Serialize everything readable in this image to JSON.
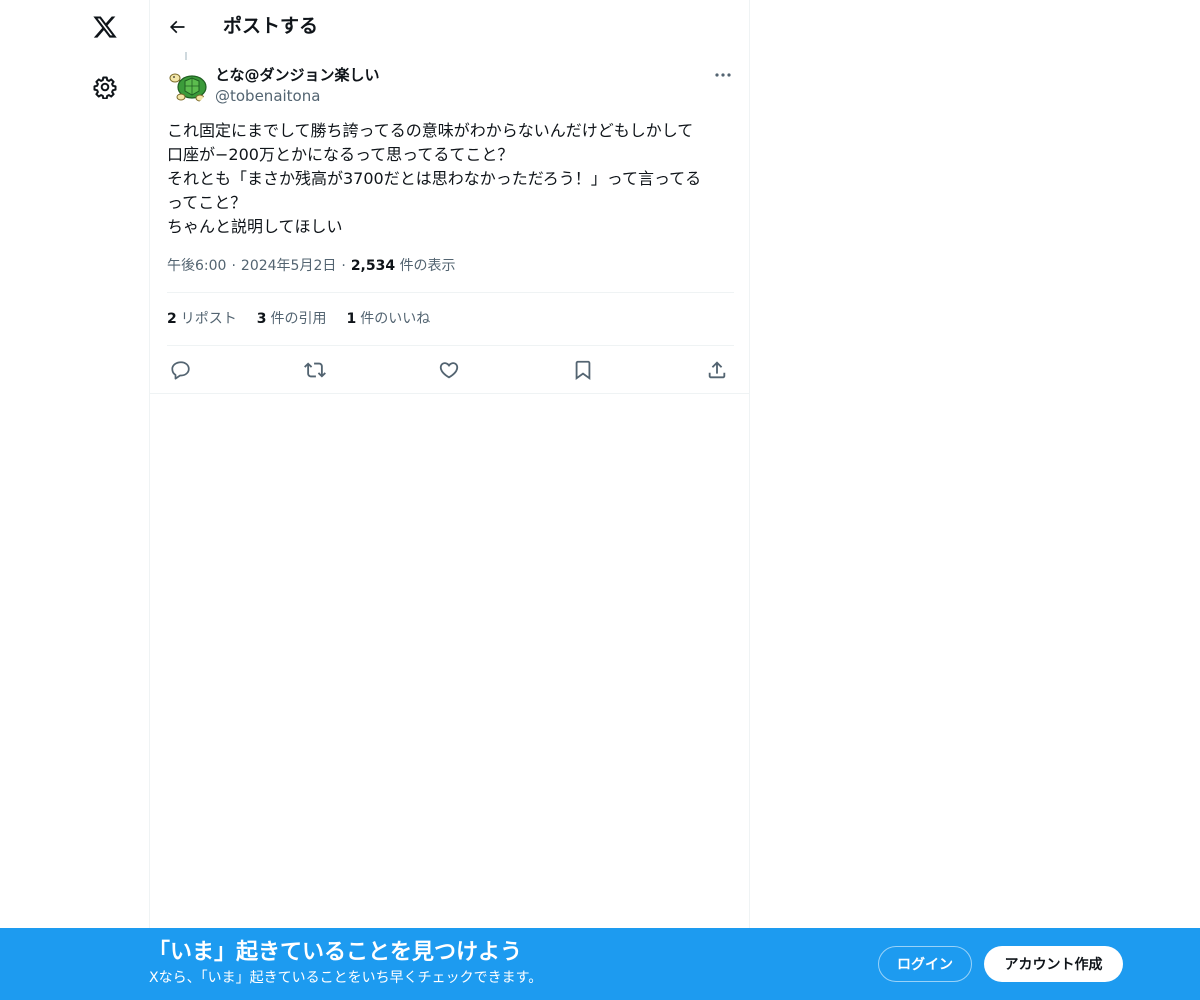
{
  "nav": {
    "logo_icon": "x-logo-icon",
    "settings_icon": "gear-icon"
  },
  "header": {
    "back_icon": "arrow-left-icon",
    "title": "ポストする"
  },
  "post": {
    "author": {
      "name": "とな@ダンジョン楽しい",
      "handle": "@tobenaitona",
      "avatar_icon": "turtle-avatar"
    },
    "more_icon": "more-dots-icon",
    "text_lines": [
      "これ固定にまでして勝ち誇ってるの意味がわからないんだけどもしかして",
      "口座が−200万とかになるって思ってるてこと？",
      "それとも「まさか残高が3700だとは思わなかっただろう！」って言ってる",
      "ってこと？",
      "ちゃんと説明してほしい"
    ],
    "time": "午後6:00",
    "date": "2024年5月2日",
    "dot": "·",
    "views_count": "2,534",
    "views_label": "件の表示",
    "stats": {
      "reposts_count": "2",
      "reposts_label": "リポスト",
      "quotes_count": "3",
      "quotes_label": "件の引用",
      "likes_count": "1",
      "likes_label": "件のいいね"
    },
    "actions": [
      "reply-icon",
      "repost-icon",
      "like-icon",
      "bookmark-icon",
      "share-icon"
    ]
  },
  "banner": {
    "title": "「いま」起きていることを見つけよう",
    "subtitle": "Xなら、「いま」起きていることをいち早くチェックできます。",
    "login_label": "ログイン",
    "signup_label": "アカウント作成"
  },
  "colors": {
    "accent": "#1d9bf0",
    "text_primary": "#0f1419",
    "text_secondary": "#536471",
    "border": "#eff3f4"
  }
}
